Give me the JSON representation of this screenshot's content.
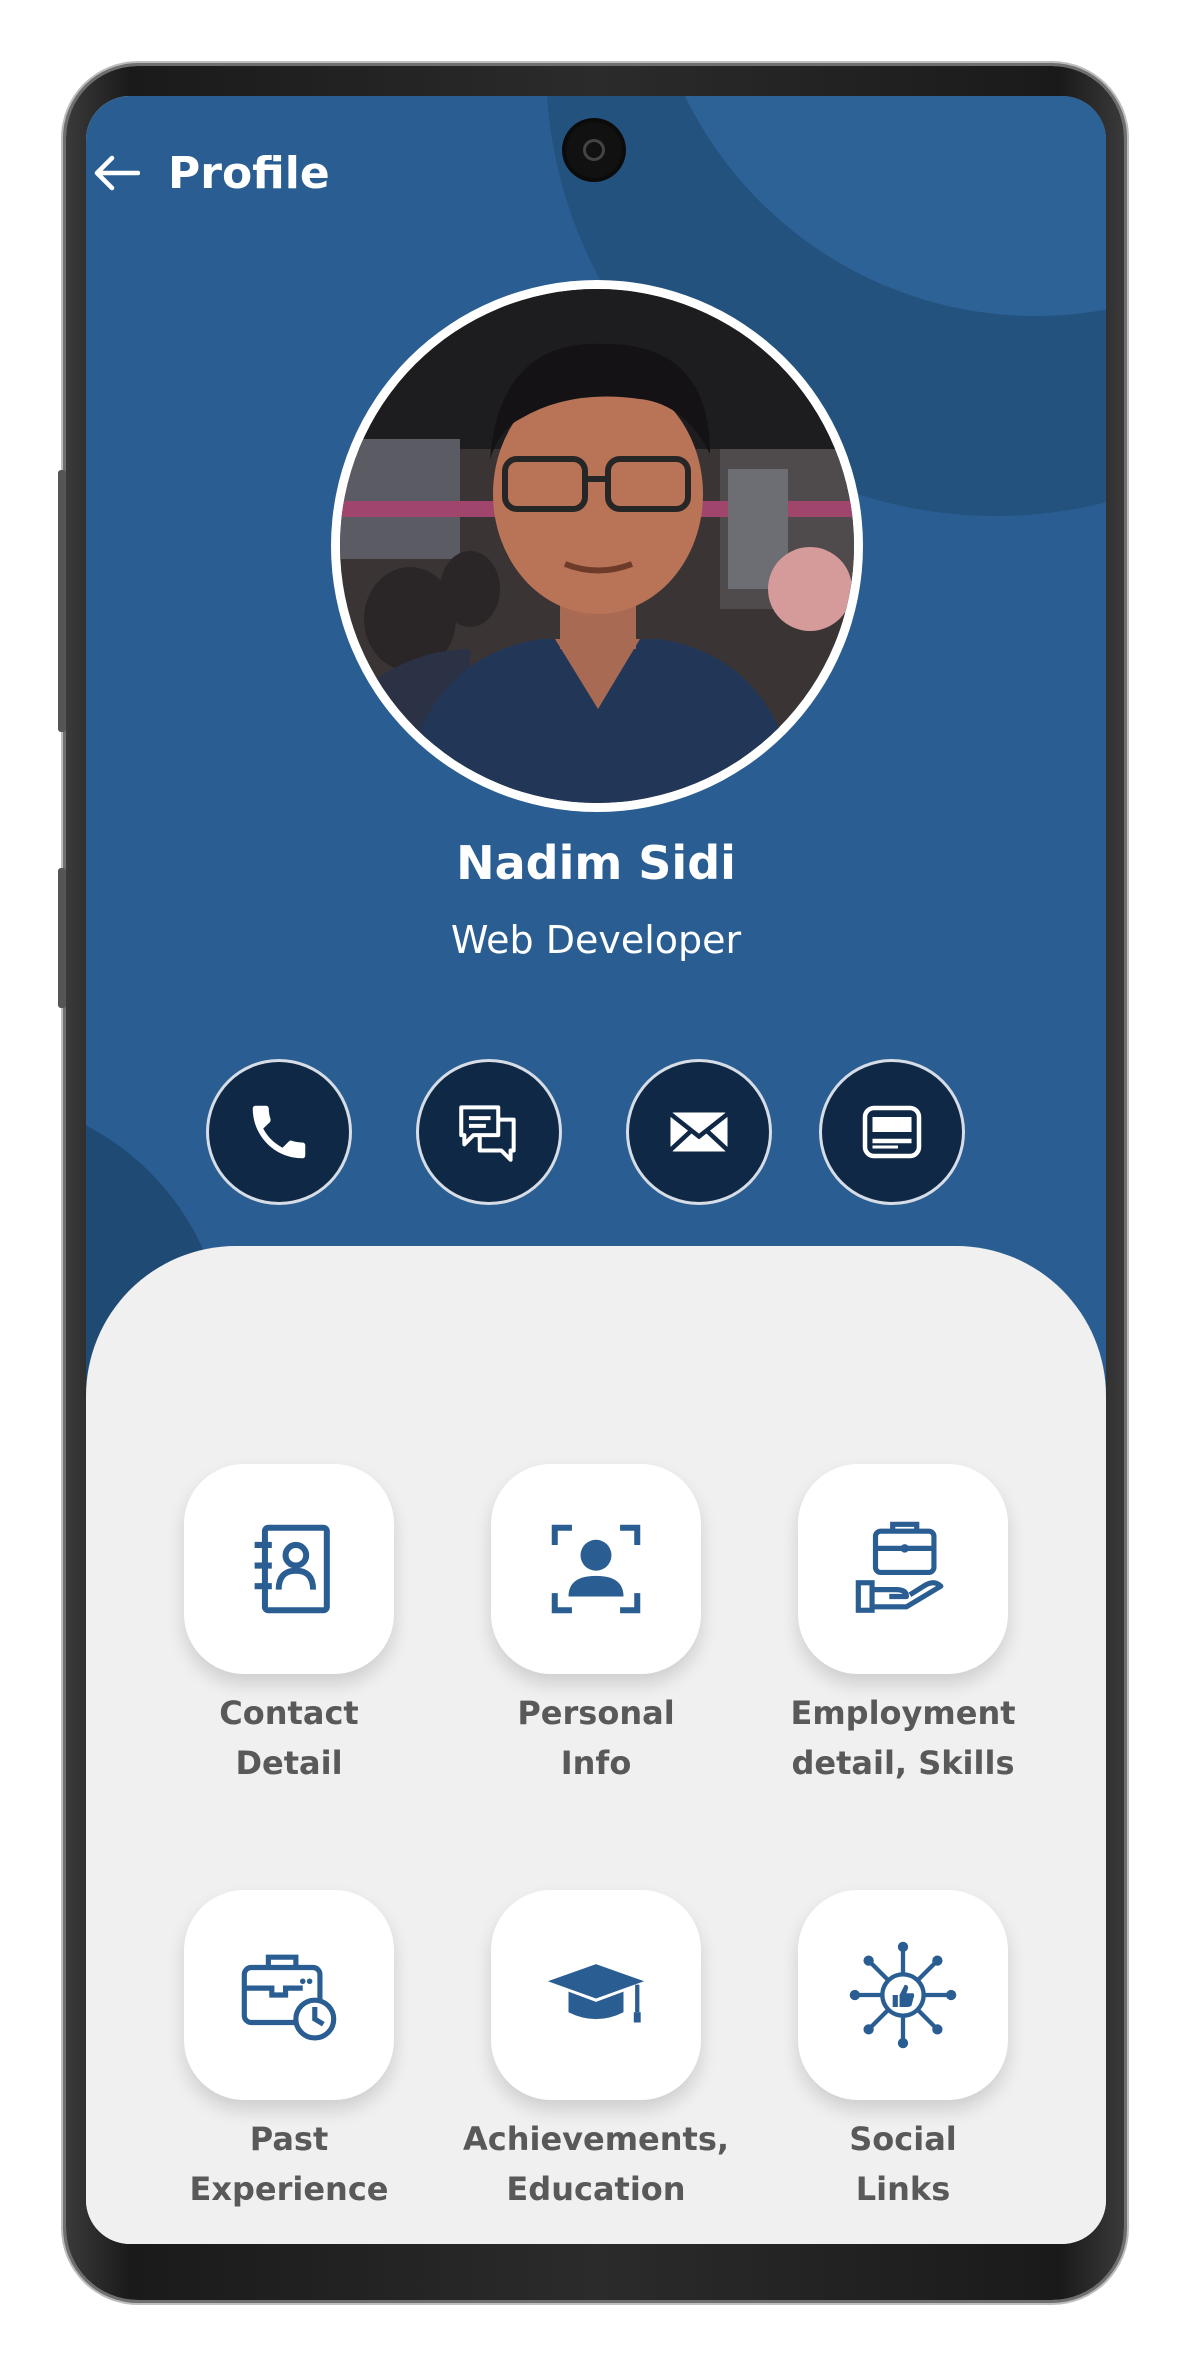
{
  "header": {
    "title": "Profile",
    "back_icon": "arrow-left-icon"
  },
  "profile": {
    "name": "Nadim Sidi",
    "role": "Web Developer"
  },
  "actions": [
    {
      "icon": "phone-icon"
    },
    {
      "icon": "chat-icon"
    },
    {
      "icon": "mail-icon"
    },
    {
      "icon": "card-icon"
    }
  ],
  "menu": {
    "contact": {
      "line1": "Contact",
      "line2": "Detail",
      "icon": "contact-book-icon"
    },
    "personal": {
      "line1": "Personal",
      "line2": "Info",
      "icon": "user-frame-icon"
    },
    "employment": {
      "line1": "Employment",
      "line2": "detail, Skills",
      "icon": "briefcase-hand-icon"
    },
    "experience": {
      "line1": "Past",
      "line2": "Experience",
      "icon": "briefcase-clock-icon"
    },
    "education": {
      "line1": "Achievements,",
      "line2": "Education",
      "icon": "graduation-cap-icon"
    },
    "social": {
      "line1": "Social",
      "line2": "Links",
      "icon": "network-like-icon"
    }
  },
  "colors": {
    "primary": "#2a5e92",
    "dark": "#0f2846",
    "panel": "#f0f0f1",
    "label": "#595959"
  }
}
